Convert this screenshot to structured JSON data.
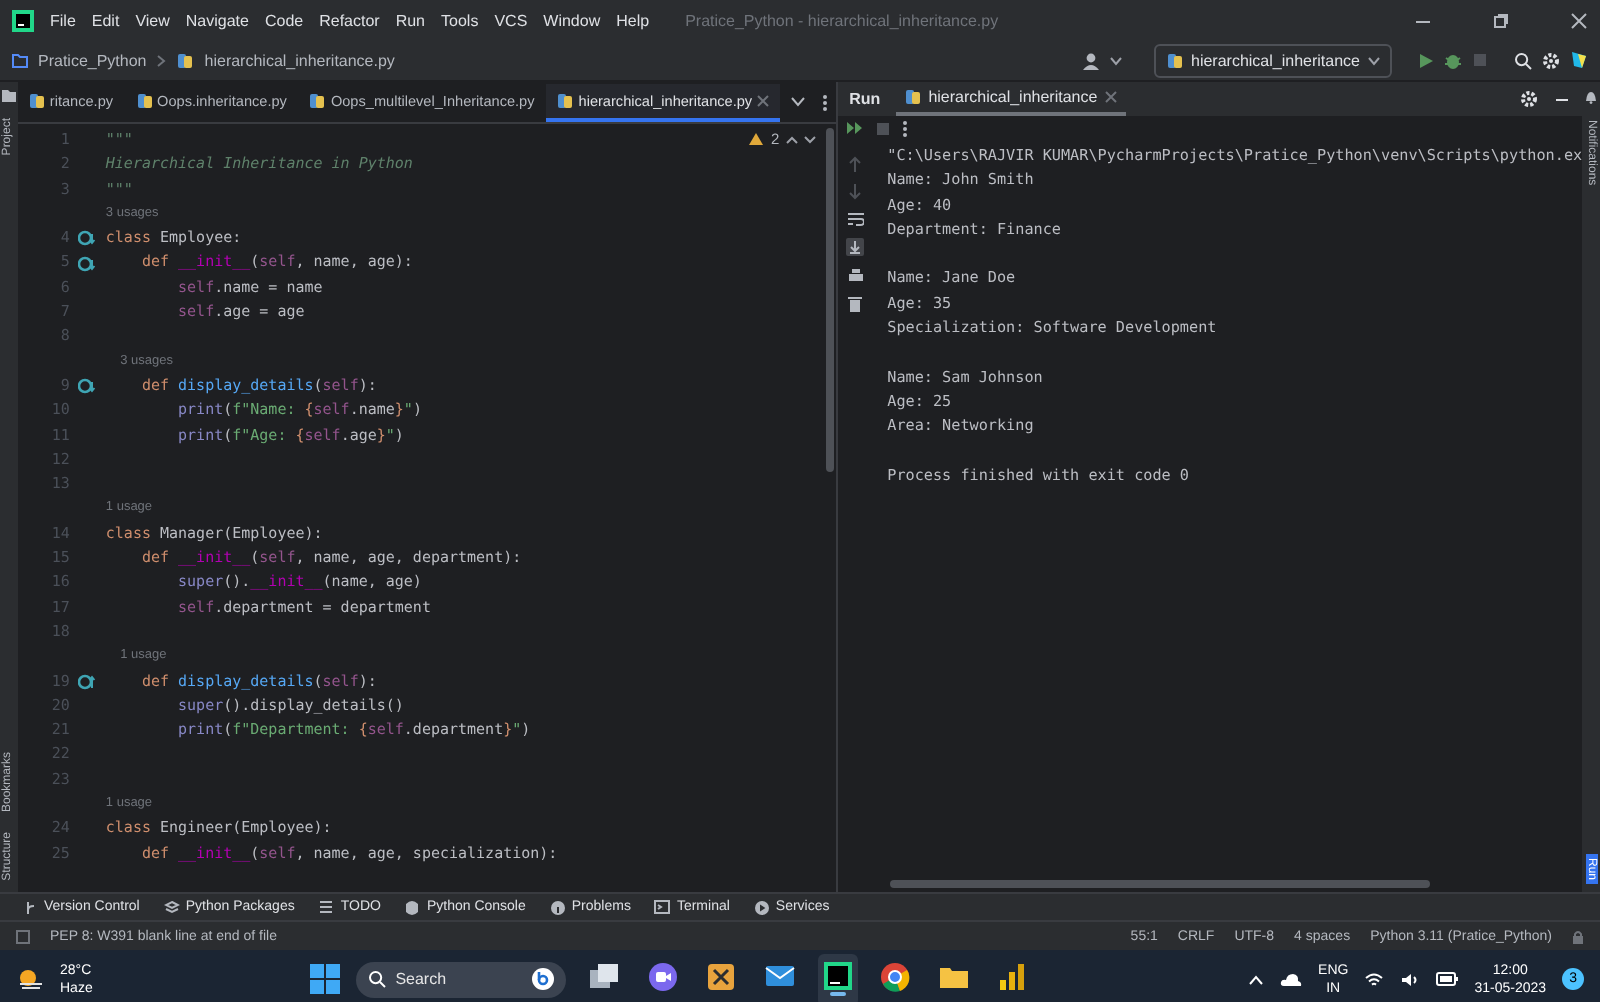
{
  "menu_bar": {
    "items": [
      "File",
      "Edit",
      "View",
      "Navigate",
      "Code",
      "Refactor",
      "Run",
      "Tools",
      "VCS",
      "Window",
      "Help"
    ],
    "title": "Pratice_Python - hierarchical_inheritance.py"
  },
  "nav_bar": {
    "breadcrumb": [
      "Pratice_Python",
      "hierarchical_inheritance.py"
    ],
    "run_config": "hierarchical_inheritance"
  },
  "left_strip": [
    {
      "label": "Project",
      "selected": false
    },
    {
      "label": "Bookmarks",
      "selected": false
    },
    {
      "label": "Structure",
      "selected": false
    }
  ],
  "right_strip": [
    {
      "label": "Notifications",
      "selected": false
    },
    {
      "label": "Run",
      "selected": true
    }
  ],
  "editor": {
    "tabs": [
      {
        "label": "ritance.py",
        "selected": false
      },
      {
        "label": "Oops.inheritance.py",
        "selected": false
      },
      {
        "label": "Oops_multilevel_Inheritance.py",
        "selected": false
      },
      {
        "label": "hierarchical_inheritance.py",
        "selected": true
      }
    ],
    "warnings": "2",
    "rows": [
      {
        "kind": "code",
        "number": "1",
        "tokens": [
          {
            "kind": "doc",
            "text": "\"\"\""
          }
        ]
      },
      {
        "kind": "code",
        "number": "2",
        "tokens": [
          {
            "kind": "doc",
            "text": "Hierarchical Inheritance in Python"
          }
        ]
      },
      {
        "kind": "code",
        "number": "3",
        "tokens": [
          {
            "kind": "doc",
            "text": "\"\"\""
          }
        ]
      },
      {
        "kind": "hint",
        "tokens": [
          {
            "kind": "hint",
            "text": "3 usages"
          }
        ]
      },
      {
        "kind": "code",
        "number": "4",
        "gutter": {
          "kind": "implemented"
        },
        "tokens": [
          {
            "kind": "keyword",
            "text": "class"
          },
          {
            "kind": "plain",
            "text": " Employee:"
          }
        ]
      },
      {
        "kind": "code",
        "number": "5",
        "gutter": {
          "kind": "implemented"
        },
        "tokens": [
          {
            "kind": "keyword",
            "text": "    def "
          },
          {
            "kind": "dunder",
            "text": "__init__"
          },
          {
            "kind": "plain",
            "text": "("
          },
          {
            "kind": "self",
            "text": "self"
          },
          {
            "kind": "plain",
            "text": ", name, age):"
          }
        ]
      },
      {
        "kind": "code",
        "number": "6",
        "tokens": [
          {
            "kind": "self",
            "text": "        self"
          },
          {
            "kind": "plain",
            "text": ".name = name"
          }
        ]
      },
      {
        "kind": "code",
        "number": "7",
        "tokens": [
          {
            "kind": "self",
            "text": "        self"
          },
          {
            "kind": "plain",
            "text": ".age = age"
          }
        ]
      },
      {
        "kind": "code",
        "number": "8",
        "tokens": []
      },
      {
        "kind": "hint",
        "tokens": [
          {
            "kind": "hint",
            "text": "    3 usages"
          }
        ]
      },
      {
        "kind": "code",
        "number": "9",
        "gutter": {
          "kind": "implemented"
        },
        "tokens": [
          {
            "kind": "keyword",
            "text": "    def "
          },
          {
            "kind": "funcdef",
            "text": "display_details"
          },
          {
            "kind": "plain",
            "text": "("
          },
          {
            "kind": "self",
            "text": "self"
          },
          {
            "kind": "plain",
            "text": "):"
          }
        ]
      },
      {
        "kind": "code",
        "number": "10",
        "tokens": [
          {
            "kind": "builtin",
            "text": "        print"
          },
          {
            "kind": "plain",
            "text": "("
          },
          {
            "kind": "string",
            "text": "f\"Name: "
          },
          {
            "kind": "brace",
            "text": "{"
          },
          {
            "kind": "self",
            "text": "self"
          },
          {
            "kind": "plain",
            "text": ".name"
          },
          {
            "kind": "brace",
            "text": "}"
          },
          {
            "kind": "string",
            "text": "\""
          },
          {
            "kind": "plain",
            "text": ")"
          }
        ]
      },
      {
        "kind": "code",
        "number": "11",
        "tokens": [
          {
            "kind": "builtin",
            "text": "        print"
          },
          {
            "kind": "plain",
            "text": "("
          },
          {
            "kind": "string",
            "text": "f\"Age: "
          },
          {
            "kind": "brace",
            "text": "{"
          },
          {
            "kind": "self",
            "text": "self"
          },
          {
            "kind": "plain",
            "text": ".age"
          },
          {
            "kind": "brace",
            "text": "}"
          },
          {
            "kind": "string",
            "text": "\""
          },
          {
            "kind": "plain",
            "text": ")"
          }
        ]
      },
      {
        "kind": "code",
        "number": "12",
        "tokens": []
      },
      {
        "kind": "code",
        "number": "13",
        "tokens": []
      },
      {
        "kind": "hint",
        "tokens": [
          {
            "kind": "hint",
            "text": "1 usage"
          }
        ]
      },
      {
        "kind": "code",
        "number": "14",
        "tokens": [
          {
            "kind": "keyword",
            "text": "class"
          },
          {
            "kind": "plain",
            "text": " Manager(Employee):"
          }
        ]
      },
      {
        "kind": "code",
        "number": "15",
        "tokens": [
          {
            "kind": "keyword",
            "text": "    def "
          },
          {
            "kind": "dunder",
            "text": "__init__"
          },
          {
            "kind": "plain",
            "text": "("
          },
          {
            "kind": "self",
            "text": "self"
          },
          {
            "kind": "plain",
            "text": ", name, age, department):"
          }
        ]
      },
      {
        "kind": "code",
        "number": "16",
        "tokens": [
          {
            "kind": "builtin",
            "text": "        super"
          },
          {
            "kind": "plain",
            "text": "()."
          },
          {
            "kind": "dunder",
            "text": "__init__"
          },
          {
            "kind": "plain",
            "text": "(name, age)"
          }
        ]
      },
      {
        "kind": "code",
        "number": "17",
        "tokens": [
          {
            "kind": "self",
            "text": "        self"
          },
          {
            "kind": "plain",
            "text": ".department = department"
          }
        ]
      },
      {
        "kind": "code",
        "number": "18",
        "tokens": []
      },
      {
        "kind": "hint",
        "tokens": [
          {
            "kind": "hint",
            "text": "    1 usage"
          }
        ]
      },
      {
        "kind": "code",
        "number": "19",
        "gutter": {
          "kind": "overrides"
        },
        "tokens": [
          {
            "kind": "keyword",
            "text": "    def "
          },
          {
            "kind": "funcdef",
            "text": "display_details"
          },
          {
            "kind": "plain",
            "text": "("
          },
          {
            "kind": "self",
            "text": "self"
          },
          {
            "kind": "plain",
            "text": "):"
          }
        ]
      },
      {
        "kind": "code",
        "number": "20",
        "tokens": [
          {
            "kind": "builtin",
            "text": "        super"
          },
          {
            "kind": "plain",
            "text": "().display_details()"
          }
        ]
      },
      {
        "kind": "code",
        "number": "21",
        "tokens": [
          {
            "kind": "builtin",
            "text": "        print"
          },
          {
            "kind": "plain",
            "text": "("
          },
          {
            "kind": "string",
            "text": "f\"Department: "
          },
          {
            "kind": "brace",
            "text": "{"
          },
          {
            "kind": "self",
            "text": "self"
          },
          {
            "kind": "plain",
            "text": ".department"
          },
          {
            "kind": "brace",
            "text": "}"
          },
          {
            "kind": "string",
            "text": "\""
          },
          {
            "kind": "plain",
            "text": ")"
          }
        ]
      },
      {
        "kind": "code",
        "number": "22",
        "tokens": []
      },
      {
        "kind": "code",
        "number": "23",
        "tokens": []
      },
      {
        "kind": "hint",
        "tokens": [
          {
            "kind": "hint",
            "text": "1 usage"
          }
        ]
      },
      {
        "kind": "code",
        "number": "24",
        "tokens": [
          {
            "kind": "keyword",
            "text": "class"
          },
          {
            "kind": "plain",
            "text": " Engineer(Employee):"
          }
        ]
      },
      {
        "kind": "code",
        "number": "25",
        "tokens": [
          {
            "kind": "keyword",
            "text": "    def "
          },
          {
            "kind": "dunder",
            "text": "__init__"
          },
          {
            "kind": "plain",
            "text": "("
          },
          {
            "kind": "self",
            "text": "self"
          },
          {
            "kind": "plain",
            "text": ", name, age, specialization):"
          }
        ]
      }
    ]
  },
  "run_panel": {
    "title": "Run",
    "tabs": [
      {
        "label": "hierarchical_inheritance",
        "selected": true
      }
    ],
    "output": [
      {
        "lines": [
          "\"C:\\Users\\RAJVIR KUMAR\\PycharmProjects\\Pratice_Python\\venv\\Scripts\\python.ex",
          "Name: John Smith",
          "Age: 40",
          "Department: Finance"
        ]
      },
      {
        "lines": [
          "Name: Jane Doe",
          "Age: 35",
          "Specialization: Software Development"
        ]
      },
      {
        "lines": [
          "Name: Sam Johnson",
          "Age: 25",
          "Area: Networking"
        ]
      },
      {
        "lines": [
          "Process finished with exit code 0"
        ]
      }
    ]
  },
  "tool_bar": [
    {
      "kind": "vcs",
      "label": "Version Control"
    },
    {
      "kind": "packages",
      "label": "Python Packages"
    },
    {
      "kind": "todo",
      "label": "TODO"
    },
    {
      "kind": "console",
      "label": "Python Console"
    },
    {
      "kind": "problems",
      "label": "Problems"
    },
    {
      "kind": "terminal",
      "label": "Terminal"
    },
    {
      "kind": "services",
      "label": "Services"
    }
  ],
  "status_bar": {
    "message": "PEP 8: W391 blank line at end of file",
    "items": [
      "55:1",
      "CRLF",
      "UTF-8",
      "4 spaces",
      "Python 3.11 (Pratice_Python)"
    ]
  },
  "taskbar": {
    "temperature": "28°C",
    "weather": "Haze",
    "search": {
      "placeholder": "Search"
    },
    "apps": [
      {
        "kind": "taskview",
        "selected": false
      },
      {
        "kind": "chat",
        "selected": false
      },
      {
        "kind": "tools",
        "selected": false
      },
      {
        "kind": "mail",
        "selected": false
      },
      {
        "kind": "ide",
        "selected": true
      },
      {
        "kind": "browser",
        "selected": false
      },
      {
        "kind": "folder",
        "selected": false
      },
      {
        "kind": "chart",
        "selected": false
      }
    ],
    "language": "ENG",
    "region": "IN",
    "time": "12:00",
    "date": "31-05-2023",
    "notifications": "3"
  }
}
